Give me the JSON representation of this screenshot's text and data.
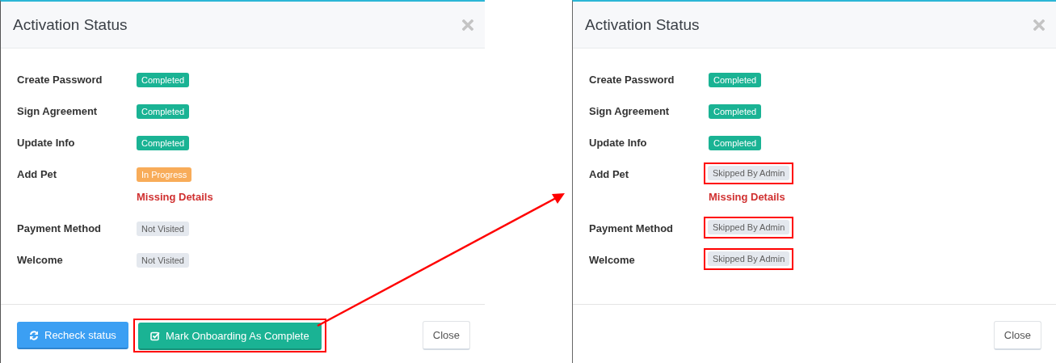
{
  "panels": [
    {
      "title": "Activation Status",
      "steps": [
        {
          "label": "Create Password",
          "status": {
            "text": "Completed",
            "kind": "completed"
          },
          "highlighted": false
        },
        {
          "label": "Sign Agreement",
          "status": {
            "text": "Completed",
            "kind": "completed"
          },
          "highlighted": false
        },
        {
          "label": "Update Info",
          "status": {
            "text": "Completed",
            "kind": "completed"
          },
          "highlighted": false
        },
        {
          "label": "Add Pet",
          "status": {
            "text": "In Progress",
            "kind": "progress"
          },
          "note": "Missing Details",
          "highlighted": false
        },
        {
          "label": "Payment Method",
          "status": {
            "text": "Not Visited",
            "kind": "neutral"
          },
          "highlighted": false
        },
        {
          "label": "Welcome",
          "status": {
            "text": "Not Visited",
            "kind": "neutral"
          },
          "highlighted": false
        }
      ],
      "buttons": [
        {
          "label": "Recheck status",
          "kind": "info",
          "highlighted": false
        },
        {
          "label": "Mark Onboarding As Complete",
          "kind": "primary",
          "highlighted": true
        },
        {
          "label": "Close",
          "kind": "default",
          "highlighted": false
        }
      ]
    },
    {
      "title": "Activation Status",
      "steps": [
        {
          "label": "Create Password",
          "status": {
            "text": "Completed",
            "kind": "completed"
          },
          "highlighted": false
        },
        {
          "label": "Sign Agreement",
          "status": {
            "text": "Completed",
            "kind": "completed"
          },
          "highlighted": false
        },
        {
          "label": "Update Info",
          "status": {
            "text": "Completed",
            "kind": "completed"
          },
          "highlighted": false
        },
        {
          "label": "Add Pet",
          "status": {
            "text": "Skipped By Admin",
            "kind": "neutral"
          },
          "note": "Missing Details",
          "highlighted": true
        },
        {
          "label": "Payment Method",
          "status": {
            "text": "Skipped By Admin",
            "kind": "neutral"
          },
          "highlighted": true
        },
        {
          "label": "Welcome",
          "status": {
            "text": "Skipped By Admin",
            "kind": "neutral"
          },
          "highlighted": true
        }
      ],
      "buttons": [
        {
          "label": "Close",
          "kind": "default",
          "highlighted": false
        }
      ]
    }
  ]
}
